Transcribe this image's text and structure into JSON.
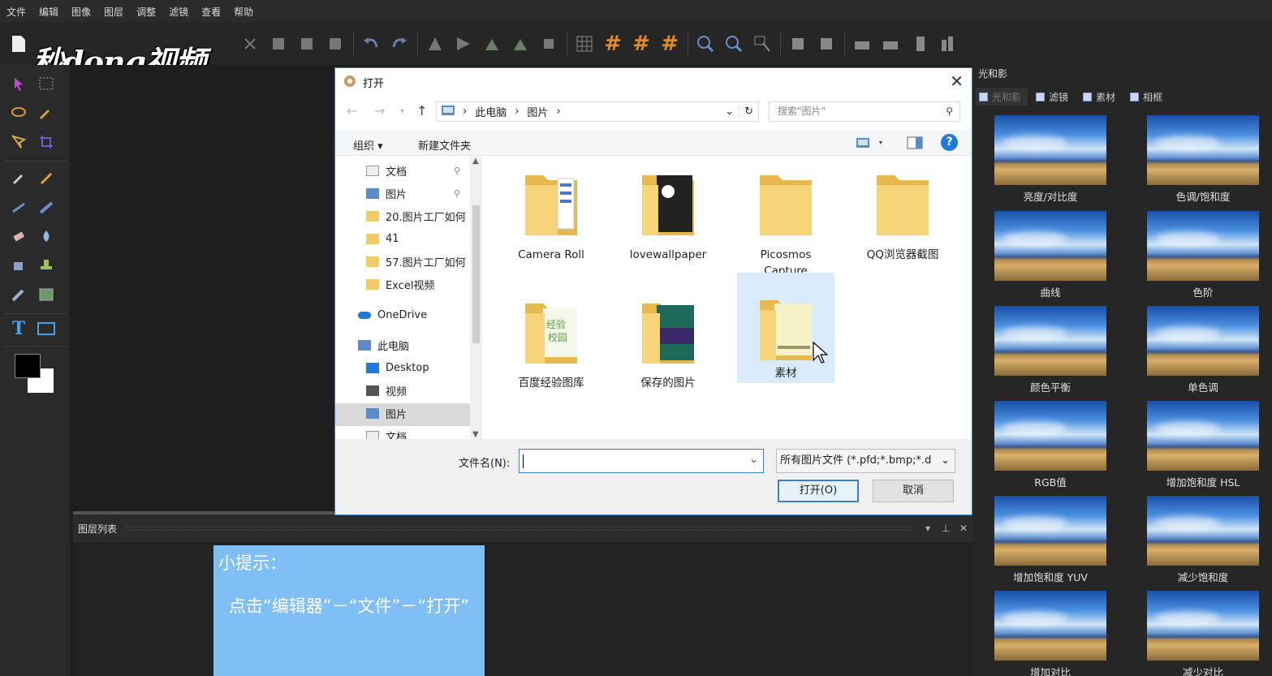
{
  "menu": [
    "文件",
    "编辑",
    "图像",
    "图层",
    "调整",
    "滤镜",
    "查看",
    "帮助"
  ],
  "watermark": "秒dong视频",
  "layers_panel": {
    "title": "图层列表"
  },
  "tip": {
    "title": "小提示：",
    "body": "点击“编辑器”－“文件”－“打开”"
  },
  "right_panel": {
    "title": "光和影",
    "tabs": [
      "光和影",
      "滤镜",
      "素材",
      "相框"
    ],
    "active_tab": 0,
    "effects": [
      "亮度/对比度",
      "色调/饱和度",
      "曲线",
      "色阶",
      "颜色平衡",
      "单色调",
      "RGB值",
      "增加饱和度 HSL",
      "增加饱和度 YUV",
      "减少饱和度",
      "增加对比",
      "减少对比"
    ]
  },
  "dialog": {
    "title": "打开",
    "breadcrumb": [
      "此电脑",
      "图片"
    ],
    "search_placeholder": "搜索\"图片\"",
    "organize": "组织 ▾",
    "new_folder": "新建文件夹",
    "nav": [
      "文档",
      "图片",
      "20.图片工厂如何",
      "41",
      "57.图片工厂如何",
      "Excel视频",
      "OneDrive",
      "此电脑",
      "Desktop",
      "视频",
      "图片",
      "文档"
    ],
    "files": [
      "Camera Roll",
      "lovewallpaper",
      "Picosmos Capture",
      "QQ浏览器截图",
      "百度经验图库",
      "保存的图片",
      "素材"
    ],
    "filename_label": "文件名(N):",
    "filename_value": "",
    "filetype": "所有图片文件 (*.pfd;*.bmp;*.d",
    "open_label": "打开(O)",
    "cancel_label": "取消"
  },
  "colors": {
    "accent": "#3c7fd1",
    "tip_bg": "#7fbff5",
    "folder": "#f2ca68"
  }
}
